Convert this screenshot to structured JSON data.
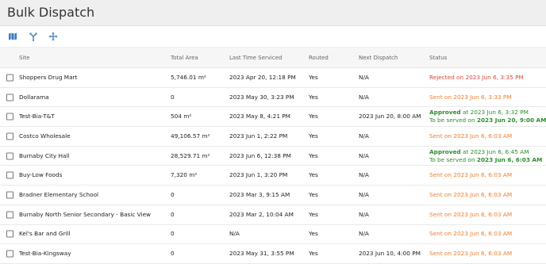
{
  "header": {
    "title": "Bulk Dispatch"
  },
  "toolbar": {
    "icons": [
      "map-icon",
      "route-split-icon",
      "move-arrows-icon"
    ],
    "accent": "#3a7bbf"
  },
  "table": {
    "columns": [
      "Site",
      "Total Area",
      "Last Time Serviced",
      "Routed",
      "Next Dispatch",
      "Status"
    ],
    "rows": [
      {
        "site": "Shoppers Drug Mart",
        "area": "5,746.01 m²",
        "last": "2023 Apr 20, 12:18 PM",
        "routed": "Yes",
        "next": "N/A",
        "status_type": "red",
        "status_line1": "Rejected on 2023 Jun 6, 3:35 PM"
      },
      {
        "site": "Dollarama",
        "area": "0",
        "last": "2023 May 30, 3:23 PM",
        "routed": "Yes",
        "next": "N/A",
        "status_type": "orange",
        "status_line1": "Sent on 2023 Jun 6, 3:33 PM"
      },
      {
        "site": "Test-Bia-T&T",
        "area": "504 m²",
        "last": "2023 May 8, 4:21 PM",
        "routed": "Yes",
        "next": "2023 Jun 20, 8:00 AM",
        "status_type": "green",
        "status_bold1": "Approved",
        "status_line1": " at 2023 Jun 6, 3:32 PM",
        "status_line2": "To be served on ",
        "status_bold2": "2023 Jun 20, 9:00 AM"
      },
      {
        "site": "Costco Wholesale",
        "area": "49,106.57 m²",
        "last": "2023 Jun 1, 2:22 PM",
        "routed": "Yes",
        "next": "N/A",
        "status_type": "orange",
        "status_line1": "Sent on 2023 Jun 6, 6:03 AM"
      },
      {
        "site": "Burnaby City Hall",
        "area": "28,529.71 m²",
        "last": "2023 Jun 6, 12:38 PM",
        "routed": "Yes",
        "next": "N/A",
        "status_type": "green",
        "status_bold1": "Approved",
        "status_line1": " at 2023 Jun 6, 6:45 AM",
        "status_line2": "To be served on ",
        "status_bold2": "2023 Jun 6, 6:03 AM"
      },
      {
        "site": "Buy-Low Foods",
        "area": "7,320 m²",
        "last": "2023 Jun 1, 3:20 PM",
        "routed": "Yes",
        "next": "N/A",
        "status_type": "orange",
        "status_line1": "Sent on 2023 Jun 6, 6:03 AM"
      },
      {
        "site": "Bradner Elementary School",
        "area": "0",
        "last": "2023 Mar 3, 9:15 AM",
        "routed": "Yes",
        "next": "N/A",
        "status_type": "orange",
        "status_line1": "Sent on 2023 Jun 6, 6:03 AM"
      },
      {
        "site": "Burnaby North Senior Secondary - Basic View",
        "area": "0",
        "last": "2023 Mar 2, 10:04 AM",
        "routed": "Yes",
        "next": "N/A",
        "status_type": "orange",
        "status_line1": "Sent on 2023 Jun 6, 6:03 AM"
      },
      {
        "site": "Kel's Bar and Grill",
        "area": "0",
        "last": "N/A",
        "routed": "Yes",
        "next": "N/A",
        "status_type": "orange",
        "status_line1": "Sent on 2023 Jun 6, 6:03 AM"
      },
      {
        "site": "Test-Bia-Kingsway",
        "area": "0",
        "last": "2023 May 31, 3:55 PM",
        "routed": "Yes",
        "next": "2023 Jun 10, 4:00 PM",
        "status_type": "orange",
        "status_line1": "Sent on 2023 Jun 6, 6:03 AM"
      }
    ]
  },
  "colors": {
    "red": "#e0453a",
    "orange": "#ee7d2b",
    "green": "#2e8b2e"
  }
}
